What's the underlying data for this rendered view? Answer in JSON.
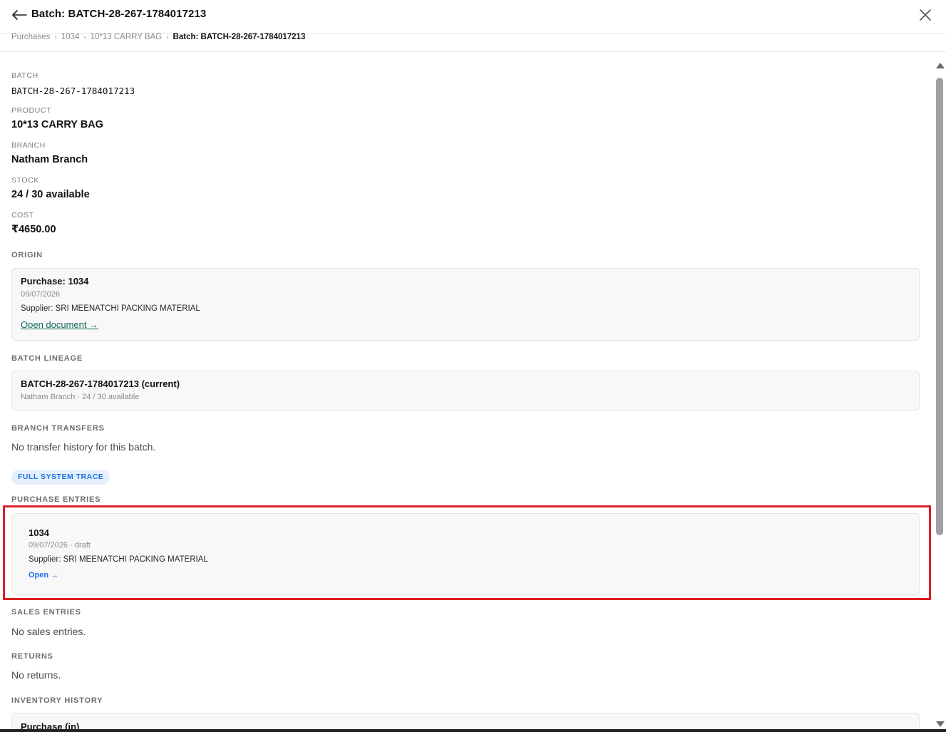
{
  "header": {
    "title": "Batch: BATCH-28-267-1784017213",
    "back_icon": "arrow-left-icon",
    "close_icon": "close-icon"
  },
  "breadcrumb": [
    "Purchases",
    "1034",
    "10*13 CARRY BAG",
    "Batch: BATCH-28-267-1784017213"
  ],
  "details": {
    "batch_label": "BATCH",
    "batch_value": "BATCH-28-267-1784017213",
    "product_label": "PRODUCT",
    "product_value": "10*13 CARRY BAG",
    "branch_label": "BRANCH",
    "branch_value": "Natham Branch",
    "stock_label": "STOCK",
    "stock_value": "24 / 30 available",
    "cost_label": "COST",
    "cost_value": "₹4650.00"
  },
  "origin": {
    "heading": "ORIGIN",
    "title": "Purchase: 1034",
    "date": "09/07/2026",
    "supplier": "Supplier: SRI MEENATCHI PACKING MATERIAL",
    "link": "Open document →"
  },
  "lineage": {
    "heading": "BATCH LINEAGE",
    "title": "BATCH-28-267-1784017213 (current)",
    "sub": "Natham Branch · 24 / 30 available"
  },
  "transfers": {
    "heading": "BRANCH TRANSFERS",
    "empty": "No transfer history for this batch."
  },
  "trace_pill": "FULL SYSTEM TRACE",
  "purchase_entries": {
    "heading": "PURCHASE ENTRIES",
    "title": "1034",
    "sub": "09/07/2026 · draft",
    "supplier": "Supplier: SRI MEENATCHI PACKING MATERIAL",
    "link": "Open →"
  },
  "sales": {
    "heading": "SALES ENTRIES",
    "empty": "No sales entries."
  },
  "returns": {
    "heading": "RETURNS",
    "empty": "No returns."
  },
  "inventory": {
    "heading": "INVENTORY HISTORY",
    "first_title": "Purchase (in)"
  },
  "colors": {
    "accent": "#1a73e8",
    "link_green": "#0f6b5c",
    "highlight": "#dc1e23"
  }
}
